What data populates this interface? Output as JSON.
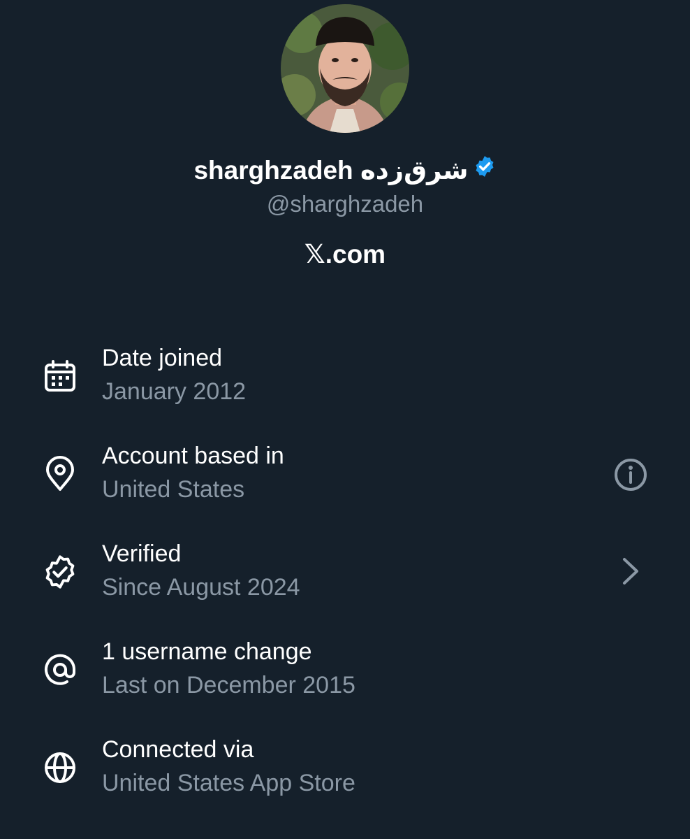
{
  "profile": {
    "display_name": "sharghzadeh شرق‌زده",
    "handle": "@sharghzadeh",
    "site": "𝕏.com",
    "verified_color": "#1d9bf0"
  },
  "rows": [
    {
      "icon": "calendar-icon",
      "label": "Date joined",
      "value": "January 2012"
    },
    {
      "icon": "location-pin-icon",
      "label": "Account based in",
      "value": "United States",
      "trailing": "info-icon"
    },
    {
      "icon": "verified-badge-icon",
      "label": "Verified",
      "value": "Since August 2024",
      "trailing": "chevron-right-icon"
    },
    {
      "icon": "at-sign-icon",
      "label": "1 username change",
      "value": "Last on December 2015"
    },
    {
      "icon": "globe-icon",
      "label": "Connected via",
      "value": "United States App Store"
    }
  ]
}
